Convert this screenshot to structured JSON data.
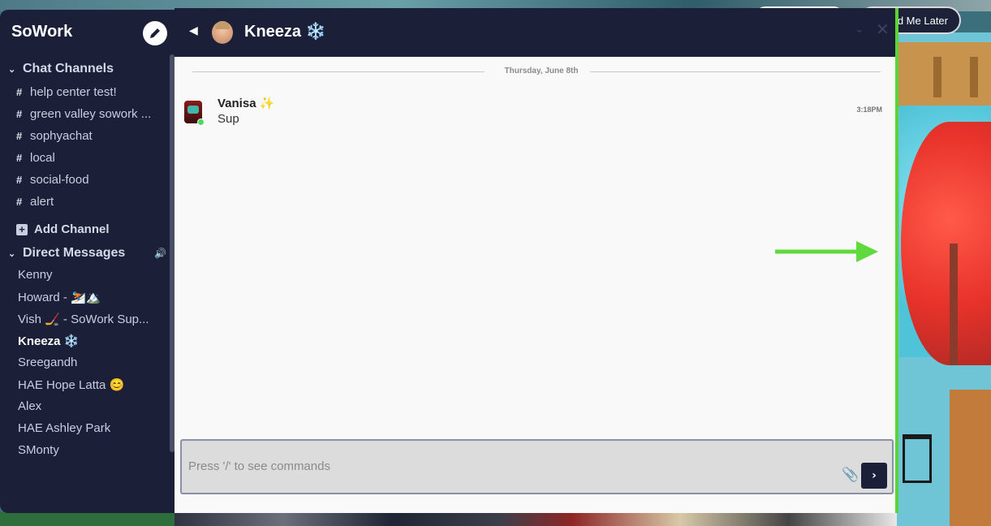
{
  "app": {
    "brand": "SoWork",
    "remind_later_label": "d Me Later"
  },
  "sidebar": {
    "channels_heading": "Chat Channels",
    "channels": [
      {
        "label": "help center test!"
      },
      {
        "label": "green valley sowork ..."
      },
      {
        "label": "sophyachat"
      },
      {
        "label": "local"
      },
      {
        "label": "social-food"
      },
      {
        "label": "alert"
      }
    ],
    "add_channel_label": "Add Channel",
    "dms_heading": "Direct Messages",
    "direct_messages": [
      {
        "label": "Kenny"
      },
      {
        "label": "Howard - ⛷️🏔️"
      },
      {
        "label": "Vish 🏒 - SoWork Sup..."
      },
      {
        "label": "Kneeza ❄️",
        "active": true
      },
      {
        "label": "Sreegandh"
      },
      {
        "label": "HAE Hope Latta 😊"
      },
      {
        "label": "Alex"
      },
      {
        "label": "HAE Ashley Park"
      },
      {
        "label": "SMonty"
      }
    ]
  },
  "chat": {
    "title": "Kneeza ❄️",
    "date_divider": "Thursday, June 8th",
    "messages": [
      {
        "author": "Vanisa ✨",
        "body": "Sup",
        "time": "3:18PM"
      }
    ],
    "composer_placeholder": "Press '/' to see commands"
  },
  "icons": {
    "compose": "pencil-icon",
    "back": "caret-left-icon",
    "collapse": "chevron-down-icon",
    "close": "close-icon",
    "attach": "paperclip-icon",
    "send": "chevron-right-icon",
    "sound": "speaker-icon"
  },
  "colors": {
    "sidebar_bg": "#1b2038",
    "accent_green": "#5bd43a",
    "online": "#4cd964"
  }
}
